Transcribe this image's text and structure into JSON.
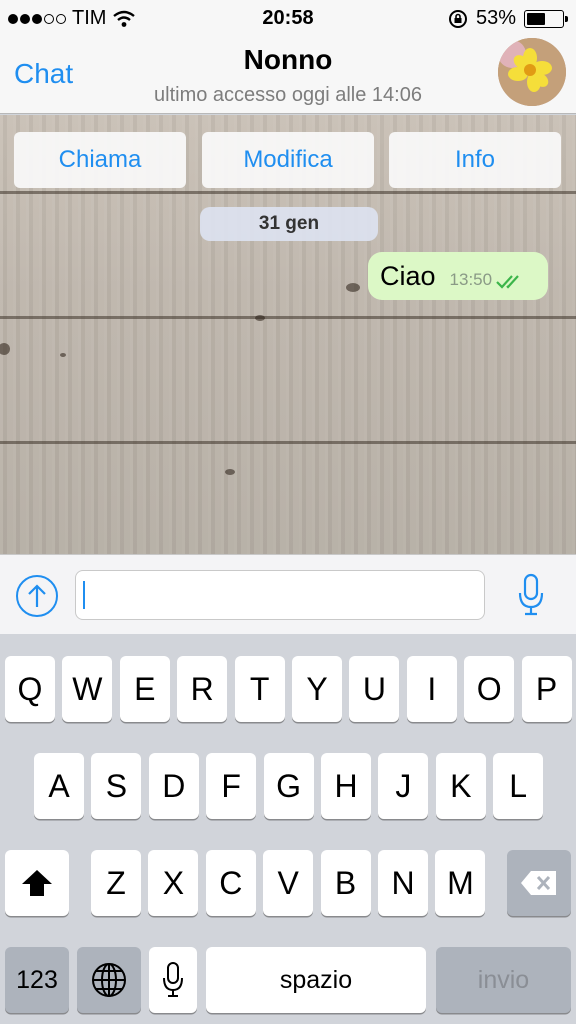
{
  "status_bar": {
    "carrier": "TIM",
    "signal_bars_filled": 3,
    "signal_bars_total": 5,
    "time": "20:58",
    "battery_percent": "53%",
    "battery_level": 0.53
  },
  "nav": {
    "back_label": "Chat",
    "title": "Nonno",
    "subtitle": "ultimo accesso oggi alle 14:06",
    "avatar_icon": "flower-photo-avatar"
  },
  "actions": {
    "call_label": "Chiama",
    "edit_label": "Modifica",
    "info_label": "Info"
  },
  "conversation": {
    "date_label": "31 gen",
    "messages": [
      {
        "text": "Ciao",
        "time": "13:50",
        "status": "read-double-check",
        "direction": "outgoing"
      }
    ]
  },
  "composer": {
    "upload_icon": "arrow-up-circle-icon",
    "value": "",
    "mic_icon": "microphone-icon"
  },
  "keyboard": {
    "row1": [
      "Q",
      "W",
      "E",
      "R",
      "T",
      "Y",
      "U",
      "I",
      "O",
      "P"
    ],
    "row2": [
      "A",
      "S",
      "D",
      "F",
      "G",
      "H",
      "J",
      "K",
      "L"
    ],
    "row3": [
      "Z",
      "X",
      "C",
      "V",
      "B",
      "N",
      "M"
    ],
    "numbers_label": "123",
    "space_label": "spazio",
    "return_label": "invio",
    "shift_icon": "shift-arrow-icon",
    "delete_icon": "backspace-icon",
    "globe_icon": "globe-icon",
    "dictation_icon": "microphone-icon"
  },
  "colors": {
    "accent": "#1f8ef0",
    "outgoing_bubble": "#dcf8c6",
    "read_ticks": "#3cb54a"
  }
}
